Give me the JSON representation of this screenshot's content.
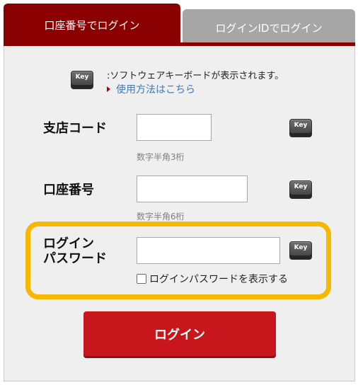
{
  "tabs": {
    "account_tab": "口座番号でログイン",
    "id_tab": "ログインIDでログイン"
  },
  "keyboard_notice": {
    "text": ":ソフトウェアキーボードが表示されます。",
    "link": "使用方法はこちら",
    "key_icon_text": "Key"
  },
  "fields": {
    "branch_code": {
      "label": "支店コード",
      "value": "",
      "hint": "数字半角3桁"
    },
    "account_number": {
      "label": "口座番号",
      "value": "",
      "hint": "数字半角6桁"
    },
    "login_password": {
      "label_line1": "ログイン",
      "label_line2": "パスワード",
      "value": "",
      "show_password_label": "ログインパスワードを表示する",
      "show_password_checked": false
    }
  },
  "login_button": "ログイン",
  "colors": {
    "brand": "#8a0000",
    "button": "#c8161d",
    "highlight": "#f6b800",
    "link": "#3c79c4"
  },
  "icons": {
    "keyboard": "keyboard-key-icon",
    "arrow": "arrow-right-icon"
  }
}
